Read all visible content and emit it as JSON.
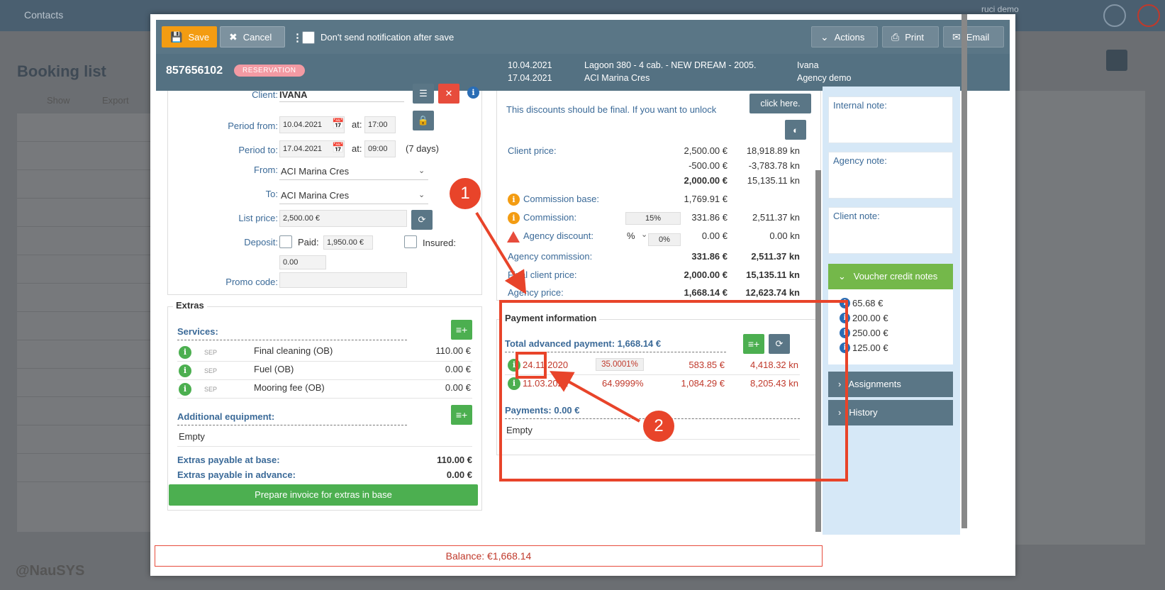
{
  "background": {
    "nav_contacts": "Contacts",
    "page_title": "Booking list",
    "show_label": "Show",
    "export_label": "Export",
    "brand": "@NauSYS",
    "user_name": "ruci demo"
  },
  "toolbar": {
    "save_label": "Save",
    "cancel_label": "Cancel",
    "notification_label": "Don't send notification after save",
    "actions_label": "Actions",
    "print_label": "Print",
    "email_label": "Email"
  },
  "header": {
    "reservation_number": "857656102",
    "status_badge": "RESERVATION",
    "date_from": "10.04.2021",
    "date_to": "17.04.2021",
    "yacht": "Lagoon 380 - 4 cab. - NEW DREAM - 2005.",
    "marina": "ACI Marina Cres",
    "client_name": "Ivana",
    "agency": "Agency demo"
  },
  "booking": {
    "client_label": "Client:",
    "client_value": "IVANA",
    "period_from_label": "Period from:",
    "period_from_date": "10.04.2021",
    "period_from_time": "17:00",
    "period_to_label": "Period to:",
    "period_to_date": "17.04.2021",
    "period_to_time": "09:00",
    "at_label": "at:",
    "days_text": "(7 days)",
    "from_label": "From:",
    "from_value": "ACI Marina Cres",
    "to_label": "To:",
    "to_value": "ACI Marina Cres",
    "list_price_label": "List price:",
    "list_price_value": "2,500.00 €",
    "deposit_label": "Deposit:",
    "paid_label": "Paid:",
    "paid_value": "1,950.00 €",
    "insured_label": "Insured:",
    "deposit_value": "0.00",
    "promo_label": "Promo code:"
  },
  "extras": {
    "legend": "Extras",
    "services_label": "Services:",
    "services": [
      {
        "tag": "SEP",
        "name": "Final cleaning (OB)",
        "price": "110.00 €"
      },
      {
        "tag": "SEP",
        "name": "Fuel (OB)",
        "price": "0.00 €"
      },
      {
        "tag": "SEP",
        "name": "Mooring fee (OB)",
        "price": "0.00 €"
      }
    ],
    "equipment_label": "Additional equipment:",
    "equipment_empty": "Empty",
    "payable_base_label": "Extras payable at base:",
    "payable_base_value": "110.00 €",
    "payable_advance_label": "Extras payable in advance:",
    "payable_advance_value": "0.00 €",
    "invoice_button": "Prepare invoice for extras in base"
  },
  "pricing": {
    "discount_notice": "This discounts should be final. If you want to unlock",
    "click_here": "click here.",
    "client_price_label": "Client price:",
    "client_price_rows": [
      {
        "eur": "2,500.00 €",
        "kn": "18,918.89 kn"
      },
      {
        "eur": "-500.00 €",
        "kn": "-3,783.78 kn"
      },
      {
        "eur": "2,000.00 €",
        "kn": "15,135.11 kn"
      }
    ],
    "commission_base_label": "Commission base:",
    "commission_base_eur": "1,769.91 €",
    "commission_label": "Commission:",
    "commission_pct": "15%",
    "commission_eur": "331.86 €",
    "commission_kn": "2,511.37 kn",
    "agency_discount_label": "Agency discount:",
    "agency_discount_unit": "%",
    "agency_discount_pct": "0%",
    "agency_discount_eur": "0.00 €",
    "agency_discount_kn": "0.00 kn",
    "agency_commission_label": "Agency commission:",
    "agency_commission_eur": "331.86 €",
    "agency_commission_kn": "2,511.37 kn",
    "final_client_price_label": "Final client price:",
    "final_client_price_eur": "2,000.00 €",
    "final_client_price_kn": "15,135.11 kn",
    "agency_price_label": "Agency price:",
    "agency_price_eur": "1,668.14 €",
    "agency_price_kn": "12,623.74 kn"
  },
  "payment": {
    "legend": "Payment information",
    "total_advanced_label": "Total advanced payment: 1,668.14 €",
    "installments": [
      {
        "date": "24.11.2020",
        "pct": "35.0001%",
        "eur": "583.85 €",
        "kn": "4,418.32 kn"
      },
      {
        "date": "11.03.2021",
        "pct": "64.9999%",
        "eur": "1,084.29 €",
        "kn": "8,205.43 kn"
      }
    ],
    "payments_label": "Payments: 0.00 €",
    "payments_empty": "Empty"
  },
  "notes": {
    "internal_label": "Internal note:",
    "agency_label": "Agency note:",
    "client_label": "Client note:"
  },
  "sidebar": {
    "voucher_label": "Voucher credit notes",
    "vouchers": [
      "65.68 €",
      "200.00 €",
      "250.00 €",
      "125.00 €"
    ],
    "assignments_label": "Assignments",
    "history_label": "History"
  },
  "balance": {
    "text": "Balance: €1,668.14"
  },
  "annotations": {
    "marker_1": "1",
    "marker_2": "2",
    "accent_color": "#e8442a"
  }
}
